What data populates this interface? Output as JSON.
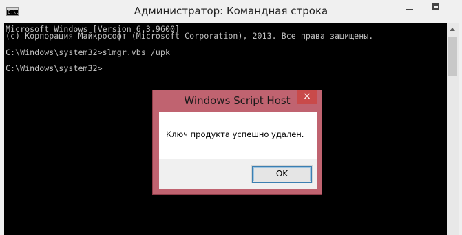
{
  "window": {
    "title": "Администратор: Командная строка",
    "icon": "console-icon",
    "icon_glyph": "C:\\."
  },
  "console": {
    "lines": [
      "Microsoft Windows [Version 6.3.9600]",
      "(c) Корпорация Майкрософт (Microsoft Corporation), 2013. Все права защищены.",
      "C:\\Windows\\system32>slmgr.vbs /upk",
      "C:\\Windows\\system32>"
    ]
  },
  "dialog": {
    "title": "Windows Script Host",
    "close_label": "×",
    "message": "Ключ продукта успешно удален.",
    "ok_label": "OK"
  },
  "colors": {
    "console_bg": "#000000",
    "console_text": "#c0c0c0",
    "dialog_frame": "#c06370",
    "close_button": "#c94a4a",
    "ok_border": "#3c7fb1"
  }
}
